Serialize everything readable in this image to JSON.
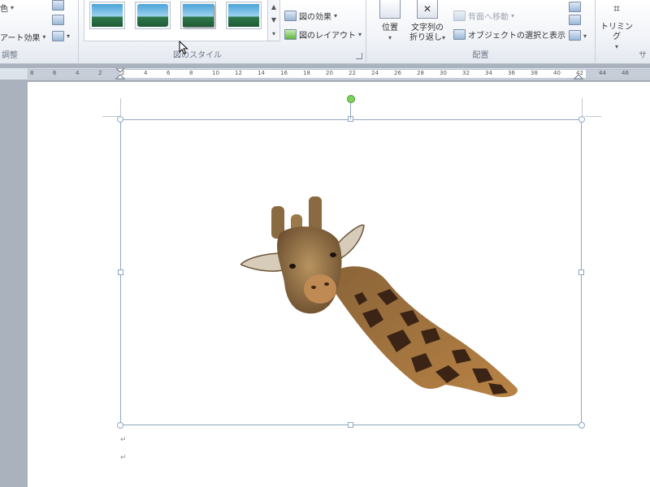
{
  "ribbon": {
    "left_group": {
      "item1_label": "色",
      "item2_label": "アート効果",
      "label": "調整"
    },
    "styles_group": {
      "label": "図のスタイル",
      "options": [
        "図の効果",
        "図のレイアウト"
      ]
    },
    "arrange_group": {
      "position_label": "位置",
      "wrap_label_1": "文字列の",
      "wrap_label_2": "折り返し",
      "send_back_label": "背面へ移動",
      "selection_pane_label": "オブジェクトの選択と表示",
      "label": "配置"
    },
    "size_group": {
      "crop_label": "トリミング",
      "label": "サ"
    }
  },
  "ruler": {
    "ticks": [
      "8",
      "6",
      "4",
      "2",
      "2",
      "4",
      "6",
      "8",
      "10",
      "12",
      "14",
      "16",
      "18",
      "20",
      "22",
      "24",
      "26",
      "28",
      "30",
      "32",
      "34",
      "36",
      "38",
      "40",
      "42",
      "44",
      "46"
    ]
  },
  "document": {
    "paragraph_marks": [
      "↵",
      "↵"
    ]
  },
  "colors": {
    "ribbon_bg": "#f4f6f9",
    "selection_frame": "#8fa7c6",
    "rotation_handle": "#7bd35a",
    "workspace": "#aab2bd"
  }
}
